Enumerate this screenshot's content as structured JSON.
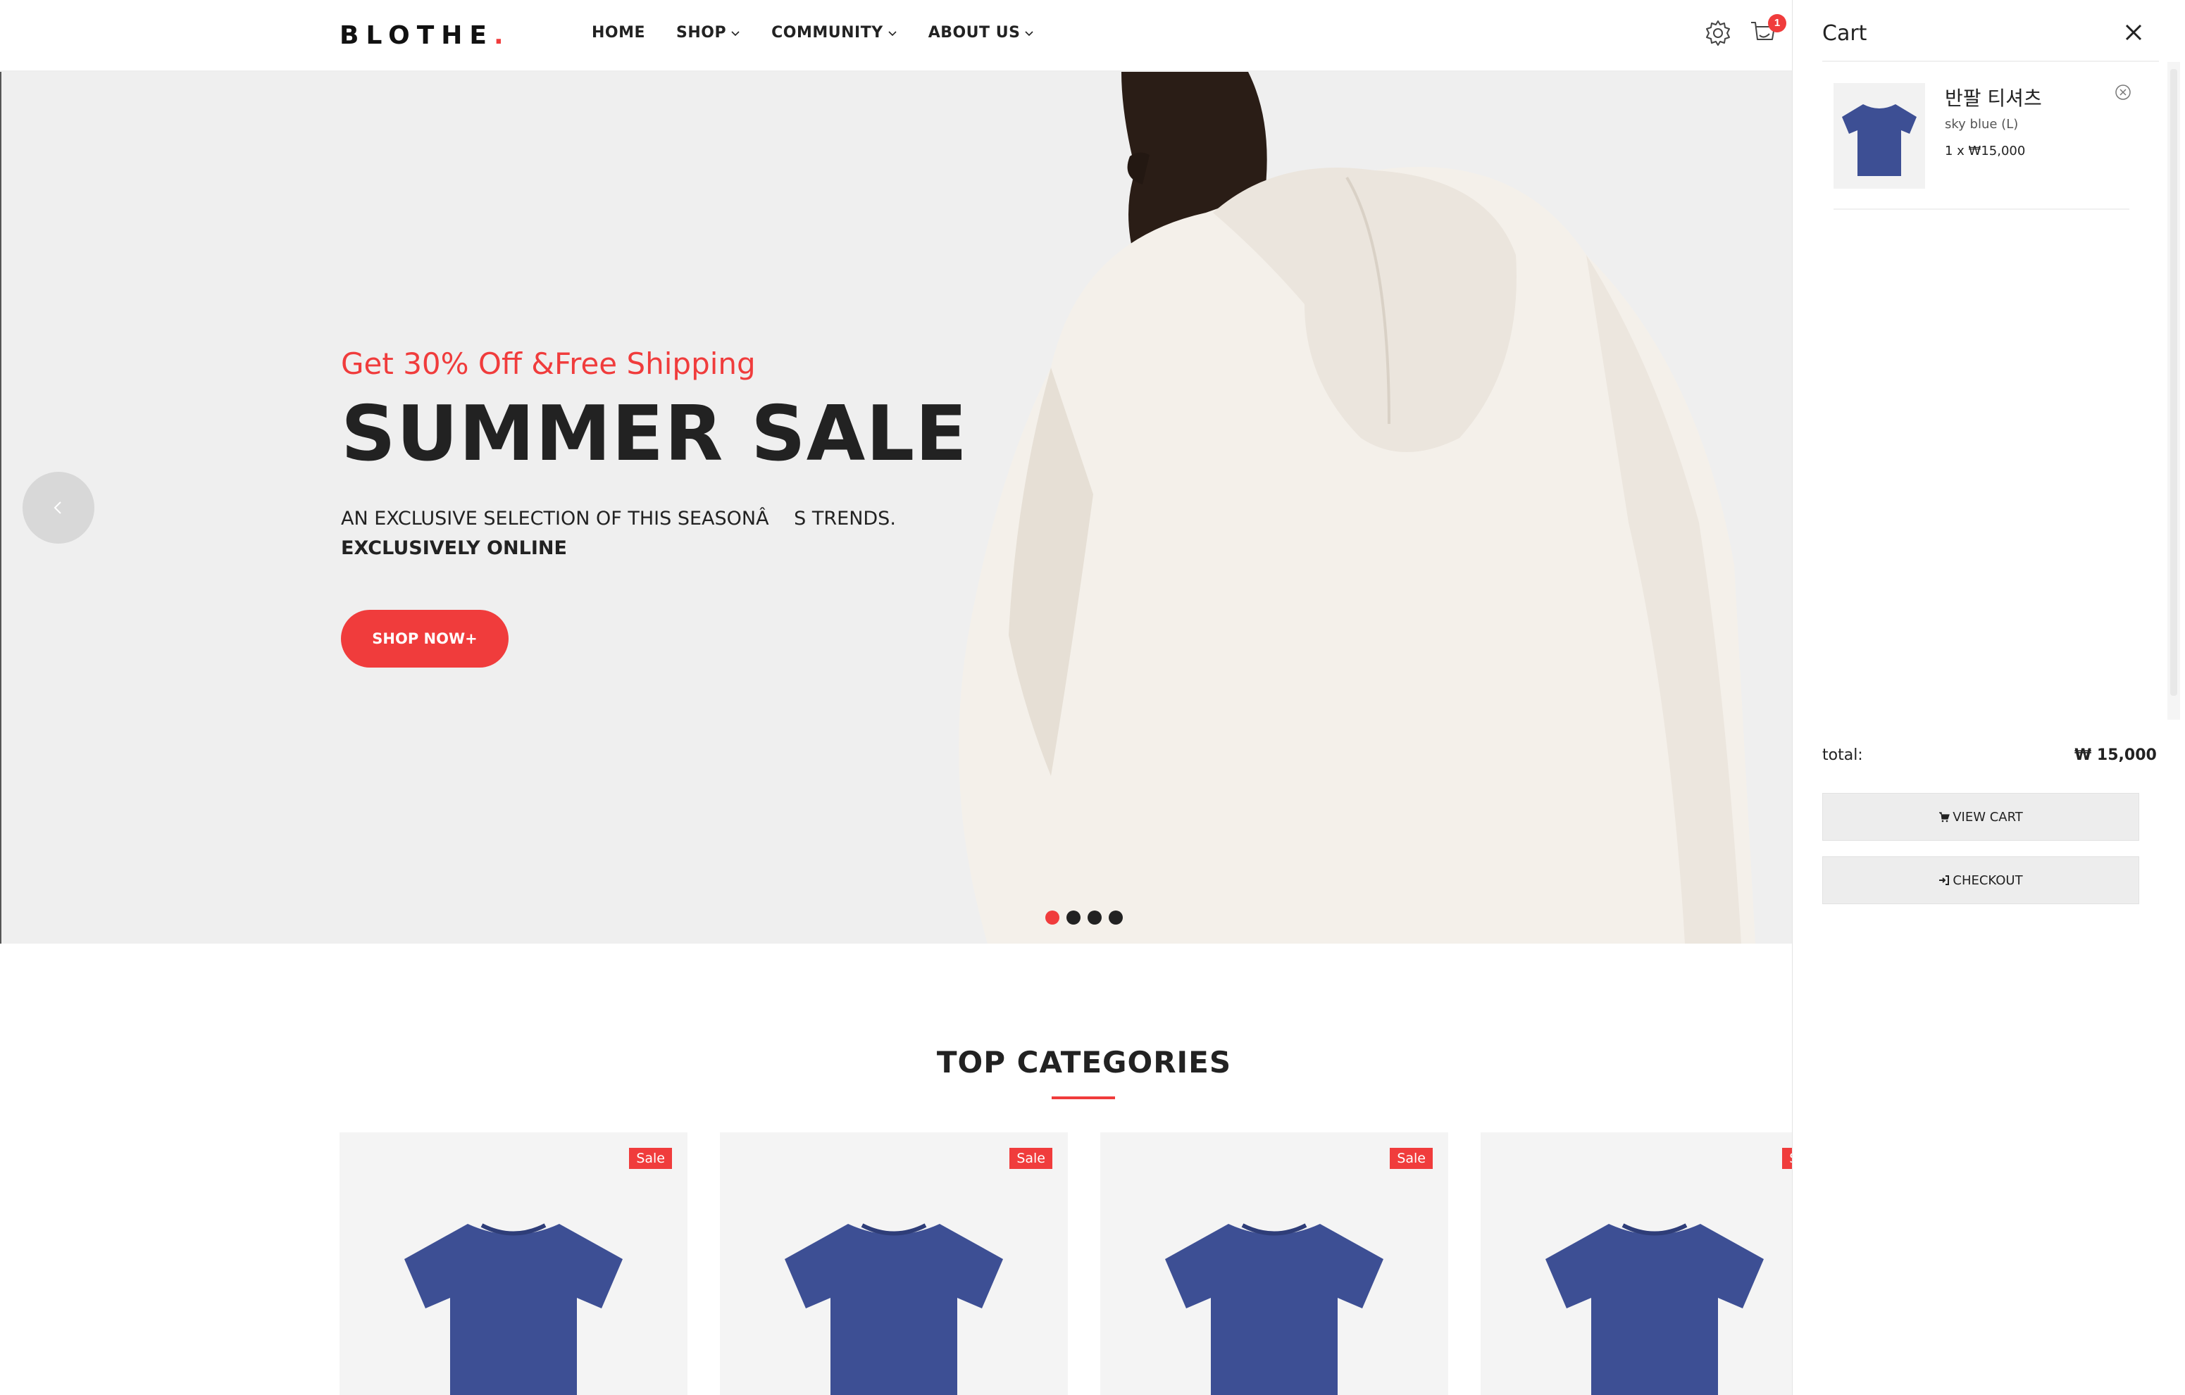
{
  "header": {
    "logo": "BLOTHE",
    "logo_dot": ".",
    "nav": [
      {
        "label": "HOME",
        "has_dropdown": false
      },
      {
        "label": "SHOP",
        "has_dropdown": true
      },
      {
        "label": "COMMUNITY",
        "has_dropdown": true
      },
      {
        "label": "ABOUT US",
        "has_dropdown": true
      }
    ],
    "cart_count": "1",
    "icons": [
      "gear-icon",
      "cart-icon"
    ]
  },
  "hero": {
    "promo": "Get 30% Off &Free Shipping",
    "title": "SUMMER SALE",
    "desc_line1": "AN EXCLUSIVE SELECTION OF THIS SEASONÂ  S TRENDS.",
    "desc_line2": "EXCLUSIVELY ONLINE",
    "cta": "SHOP NOW+",
    "slides": 4,
    "active_slide": 1
  },
  "categories": {
    "title": "TOP CATEGORIES",
    "cards": [
      {
        "badge": "Sale"
      },
      {
        "badge": "Sale"
      },
      {
        "badge": "Sale"
      },
      {
        "badge": "Sa"
      }
    ]
  },
  "cart": {
    "title": "Cart",
    "items": [
      {
        "name": "반팔 티셔츠",
        "variant": "sky blue (L)",
        "qty_price": "1 x ₩15,000"
      }
    ],
    "total_label": "total:",
    "total_value": "₩ 15,000",
    "view_cart": "VIEW CART",
    "checkout": "CHECKOUT"
  },
  "colors": {
    "accent": "#f03c3c",
    "tshirt": "#3d4f94",
    "hero_bg": "#efefef"
  }
}
